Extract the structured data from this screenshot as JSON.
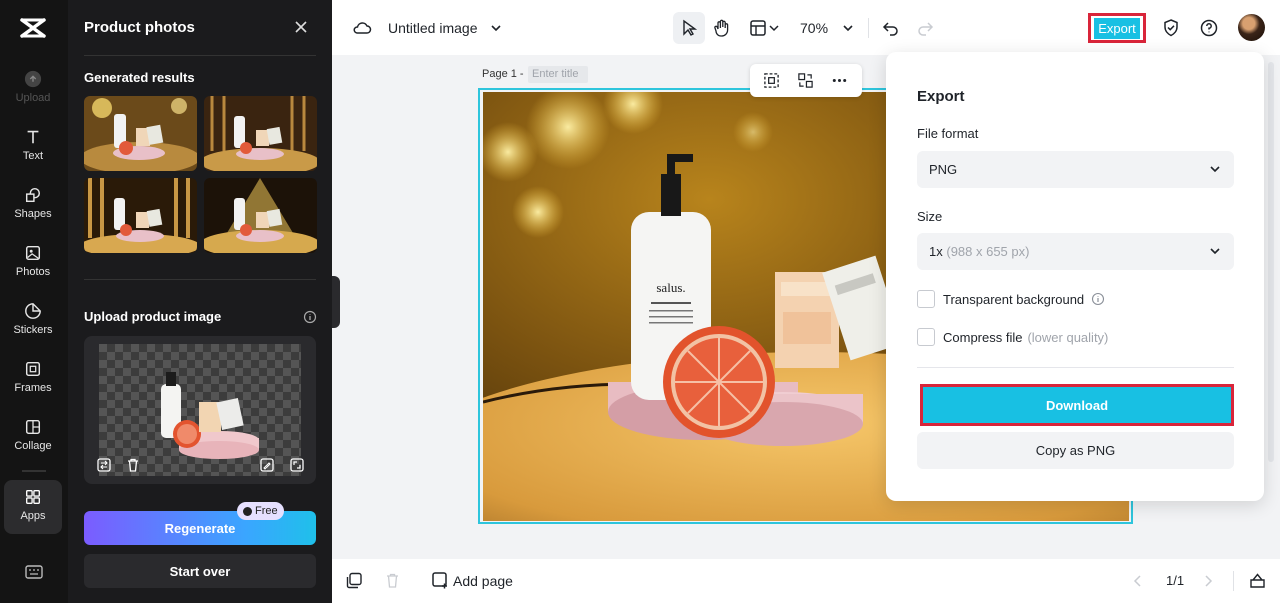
{
  "rail": {
    "items": [
      {
        "label": "Upload"
      },
      {
        "label": "Text"
      },
      {
        "label": "Shapes"
      },
      {
        "label": "Photos"
      },
      {
        "label": "Stickers"
      },
      {
        "label": "Frames"
      },
      {
        "label": "Collage"
      },
      {
        "label": "Apps"
      }
    ]
  },
  "panel": {
    "title": "Product photos",
    "generated_title": "Generated results",
    "upload_title": "Upload product image",
    "regenerate_label": "Regenerate",
    "free_badge": "Free",
    "start_over_label": "Start over"
  },
  "topbar": {
    "doc_title": "Untitled image",
    "zoom": "70%",
    "export_label": "Export"
  },
  "canvas": {
    "page_label": "Page 1 -",
    "title_placeholder": "Enter title"
  },
  "bottombar": {
    "add_page_label": "Add page",
    "pager": "1/1"
  },
  "export_panel": {
    "title": "Export",
    "file_format_label": "File format",
    "file_format_value": "PNG",
    "size_label": "Size",
    "size_value": "1x",
    "size_detail": "(988 x 655 px)",
    "transparent_label": "Transparent background",
    "compress_label": "Compress file",
    "compress_note": "(lower quality)",
    "download_label": "Download",
    "copy_label": "Copy as PNG"
  },
  "colors": {
    "accent": "#18c0e3",
    "highlight": "#d9253a",
    "panel_bg": "#1b1b1d",
    "rail_bg": "#141414"
  }
}
